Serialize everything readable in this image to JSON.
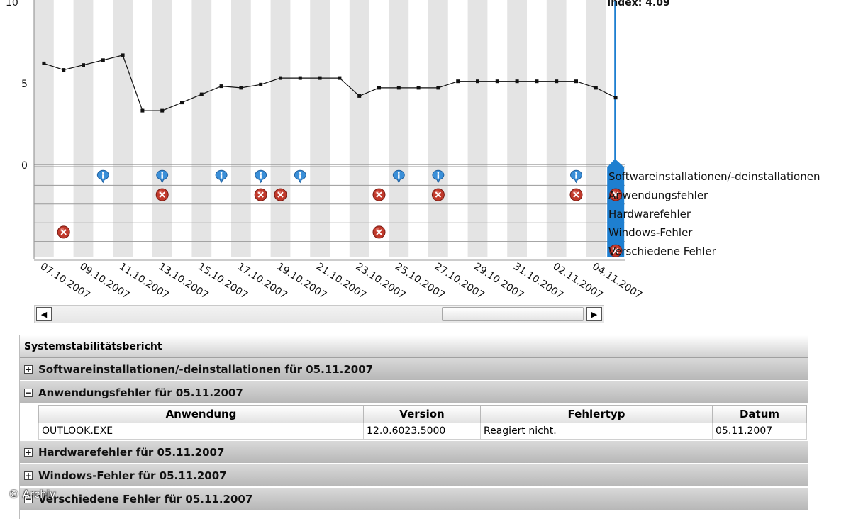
{
  "chart_data": {
    "type": "line",
    "title": "",
    "xlabel": "",
    "ylabel": "",
    "ylim": [
      0,
      10
    ],
    "y_ticks": [
      "0",
      "5",
      "10"
    ],
    "index_label": "Index: 4.09",
    "x_tick_labels": [
      "07.10.2007",
      "09.10.2007",
      "11.10.2007",
      "13.10.2007",
      "15.10.2007",
      "17.10.2007",
      "19.10.2007",
      "21.10.2007",
      "23.10.2007",
      "25.10.2007",
      "27.10.2007",
      "29.10.2007",
      "31.10.2007",
      "02.11.2007",
      "04.11.2007"
    ],
    "series": [
      {
        "values": [
          6.2,
          5.8,
          6.1,
          6.4,
          6.7,
          3.3,
          3.3,
          3.8,
          4.3,
          4.8,
          4.7,
          4.9,
          5.3,
          5.3,
          5.3,
          5.3,
          4.2,
          4.7,
          4.7,
          4.7,
          4.7,
          5.1,
          5.1,
          5.1,
          5.1,
          5.1,
          5.1,
          5.1,
          4.7,
          4.1
        ]
      }
    ],
    "event_rows": [
      {
        "label": "Softwareinstallationen/-deinstallationen",
        "type": "info",
        "days": [
          4,
          7,
          10,
          12,
          14,
          19,
          21,
          28
        ],
        "selected_icon": false
      },
      {
        "label": "Anwendungsfehler",
        "type": "error",
        "days": [
          7,
          12,
          13,
          18,
          21,
          28
        ],
        "selected_icon": true
      },
      {
        "label": "Hardwarefehler",
        "type": "error",
        "days": [],
        "selected_icon": false
      },
      {
        "label": "Windows-Fehler",
        "type": "error",
        "days": [
          2,
          18
        ],
        "selected_icon": false
      },
      {
        "label": "Verschiedene Fehler",
        "type": "error",
        "days": [],
        "selected_icon": true
      }
    ]
  },
  "report": {
    "title": "Systemstabilitätsbericht",
    "sections": [
      {
        "expander": "+",
        "label": "Softwareinstallationen/-deinstallationen für 05.11.2007"
      },
      {
        "expander": "−",
        "label": "Anwendungsfehler für 05.11.2007"
      },
      {
        "expander": "+",
        "label": "Hardwarefehler für 05.11.2007"
      },
      {
        "expander": "+",
        "label": "Windows-Fehler für 05.11.2007"
      },
      {
        "expander": "−",
        "label": "Verschiedene Fehler für 05.11.2007"
      }
    ],
    "table": {
      "headers": [
        "Anwendung",
        "Version",
        "Fehlertyp",
        "Datum"
      ],
      "rows": [
        [
          "OUTLOOK.EXE",
          "12.0.6023.5000",
          "Reagiert nicht.",
          "05.11.2007"
        ]
      ]
    }
  },
  "watermark": "© Archiv",
  "colors": {
    "selection": "#1e7fd0",
    "error": "#c0392b",
    "info": "#3a8fd8"
  }
}
